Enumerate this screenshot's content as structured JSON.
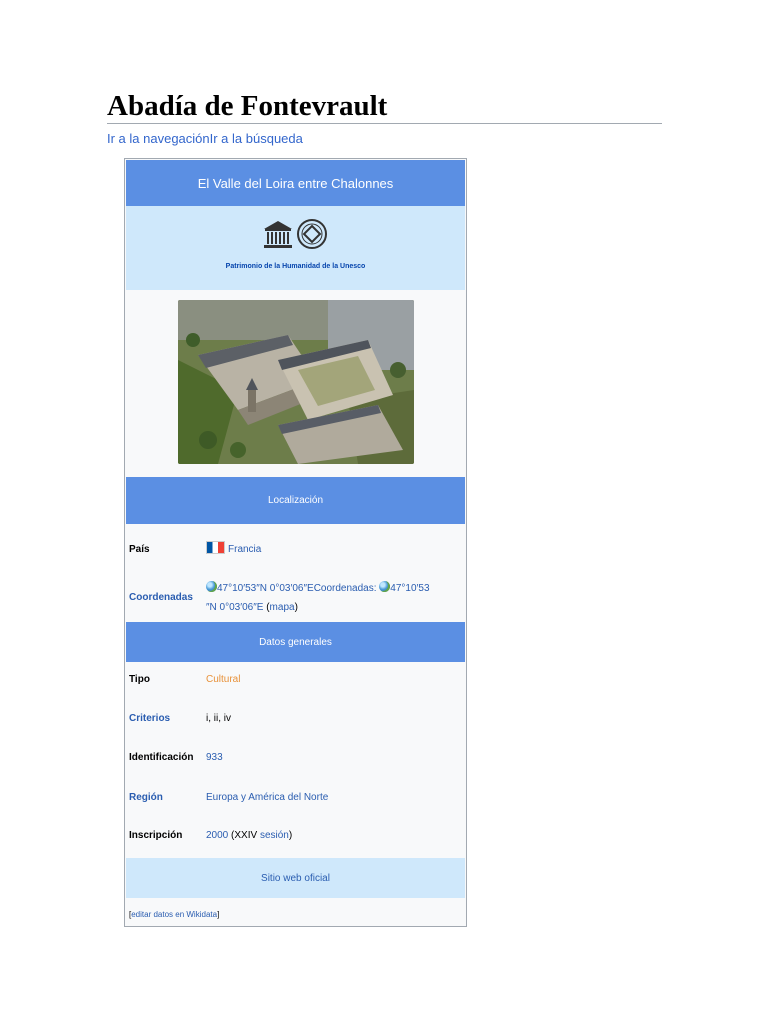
{
  "page": {
    "title": "Abadía de Fontevrault",
    "jump_links": [
      "Ir a la navegación",
      "Ir a la búsqueda"
    ]
  },
  "infobox": {
    "header": "El Valle del Loira entre Chalonnes",
    "heritage_label": "Patrimonio de la Humanidad de la Unesco",
    "image_alt": "Vista aérea de la Abadía de Fontevrault",
    "sections": {
      "localizacion": "Localización",
      "datos_generales": "Datos generales"
    },
    "rows": {
      "pais": {
        "label": "País",
        "value": "Francia"
      },
      "coordenadas": {
        "label": "Coordenadas",
        "line1_part1": "47°10′53″N 0°03′06″E",
        "line1_part2": "Coordenadas: ",
        "line1_part3": "47°10′53",
        "line2_part1": "″N 0°03′06″E",
        "line2_open": " (",
        "line2_link": "mapa",
        "line2_close": ")"
      },
      "tipo": {
        "label": "Tipo",
        "value": "Cultural"
      },
      "criterios": {
        "label": "Criterios",
        "value": "i, ii, iv"
      },
      "identificacion": {
        "label": "Identificación",
        "value": "933"
      },
      "region": {
        "label": "Región",
        "value": "Europa y América del Norte"
      },
      "inscripcion": {
        "label": "Inscripción",
        "year": "2000",
        "middle": " (XXIV ",
        "session": "sesión",
        "end": ")"
      }
    },
    "website": "Sitio web oficial",
    "edit": {
      "open": "[",
      "link": "editar datos en Wikidata",
      "close": "]"
    }
  },
  "colors": {
    "header_blue": "#5b8fe3",
    "light_blue": "#cfe8fb",
    "link": "#2a5db0",
    "cultural_orange": "#e8923a"
  }
}
